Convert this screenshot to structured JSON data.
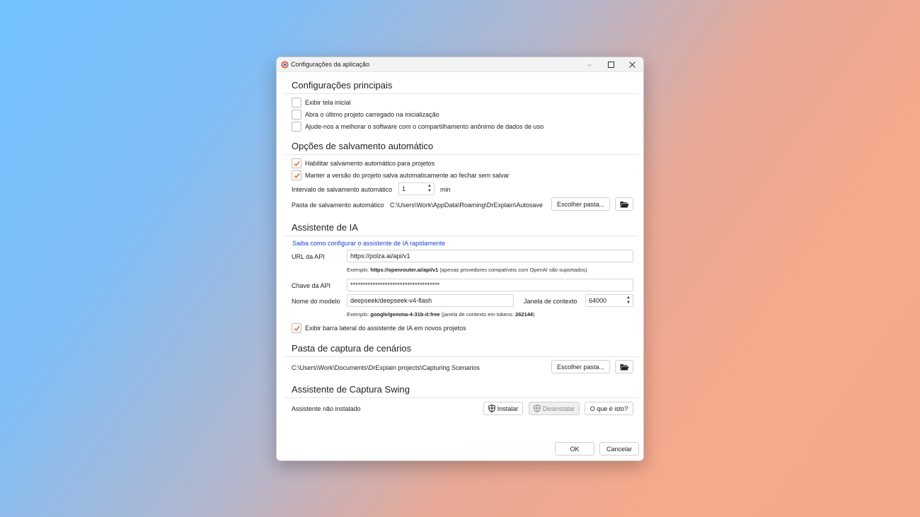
{
  "window": {
    "title": "Configurações da aplicação",
    "controls": {
      "minimize": "–",
      "maximize": "□",
      "close": "✕"
    }
  },
  "main_settings": {
    "title": "Configurações principais",
    "items": [
      {
        "label": "Exibir tela inicial",
        "checked": false
      },
      {
        "label": "Abra o último projeto carregado na inicialização",
        "checked": false
      },
      {
        "label": "Ajude-nos a melhorar o software com o compartilhamento anônimo de dados de uso",
        "checked": false
      }
    ]
  },
  "autosave": {
    "title": "Opções de salvamento automático",
    "items": [
      {
        "label": "Habilitar salvamento automático para projetos",
        "checked": true
      },
      {
        "label": "Manter a versão do projeto salva automaticamente ao fechar sem salvar",
        "checked": true
      }
    ],
    "interval_label": "Intervalo de salvamento automático",
    "interval_value": "1",
    "interval_unit": "min",
    "folder_label": "Pasta de salvamento automático",
    "folder_path": "C:\\Users\\Work\\AppData\\Roaming\\DrExplain\\Autosave",
    "choose_folder_label": "Escolher pasta..."
  },
  "ai_assistant": {
    "title": "Assistente de IA",
    "link_text": "Saiba como configurar o assistente de IA rapidamente",
    "api_url_label": "URL da API",
    "api_url_value": "https://polza.ai/api/v1",
    "api_url_hint_prefix": "Exemplo:",
    "api_url_hint_example": "https://openrouter.ai/api/v1",
    "api_url_hint_suffix": "(apenas provedores compatíveis com OpenAI são suportados)",
    "api_key_label": "Chave da API",
    "api_key_value": "************************************",
    "model_label": "Nome do modelo",
    "model_value": "deepseek/deepseek-v4-flash",
    "context_label": "Janela de contexto",
    "context_value": "64000",
    "model_hint_prefix": "Exemplo:",
    "model_hint_example": "google/gemma-4-31b-it:free",
    "model_hint_middle": "(janela de contexto em tokens:",
    "model_hint_tokens": "262144",
    "model_hint_end": ")",
    "sidebar_checkbox_label": "Exibir barra lateral do assistente de IA em novos projetos",
    "sidebar_checked": true
  },
  "scenario_capture": {
    "title": "Pasta de captura de cenários",
    "folder_path": "C:\\Users\\Work\\Documents\\DrExplain projects\\Capturing Scenarios",
    "choose_folder_label": "Escolher pasta..."
  },
  "swing_capture": {
    "title": "Assistente de Captura Swing",
    "status": "Assistente não instalado",
    "install_label": "Instalar",
    "uninstall_label": "Desinstalar",
    "what_label": "O que é isto?"
  },
  "footer": {
    "ok_label": "OK",
    "cancel_label": "Cancelar"
  },
  "colors": {
    "accent_check": "#e05a1c",
    "link": "#1a3fd6",
    "section_rule": "#dfe7ee"
  }
}
